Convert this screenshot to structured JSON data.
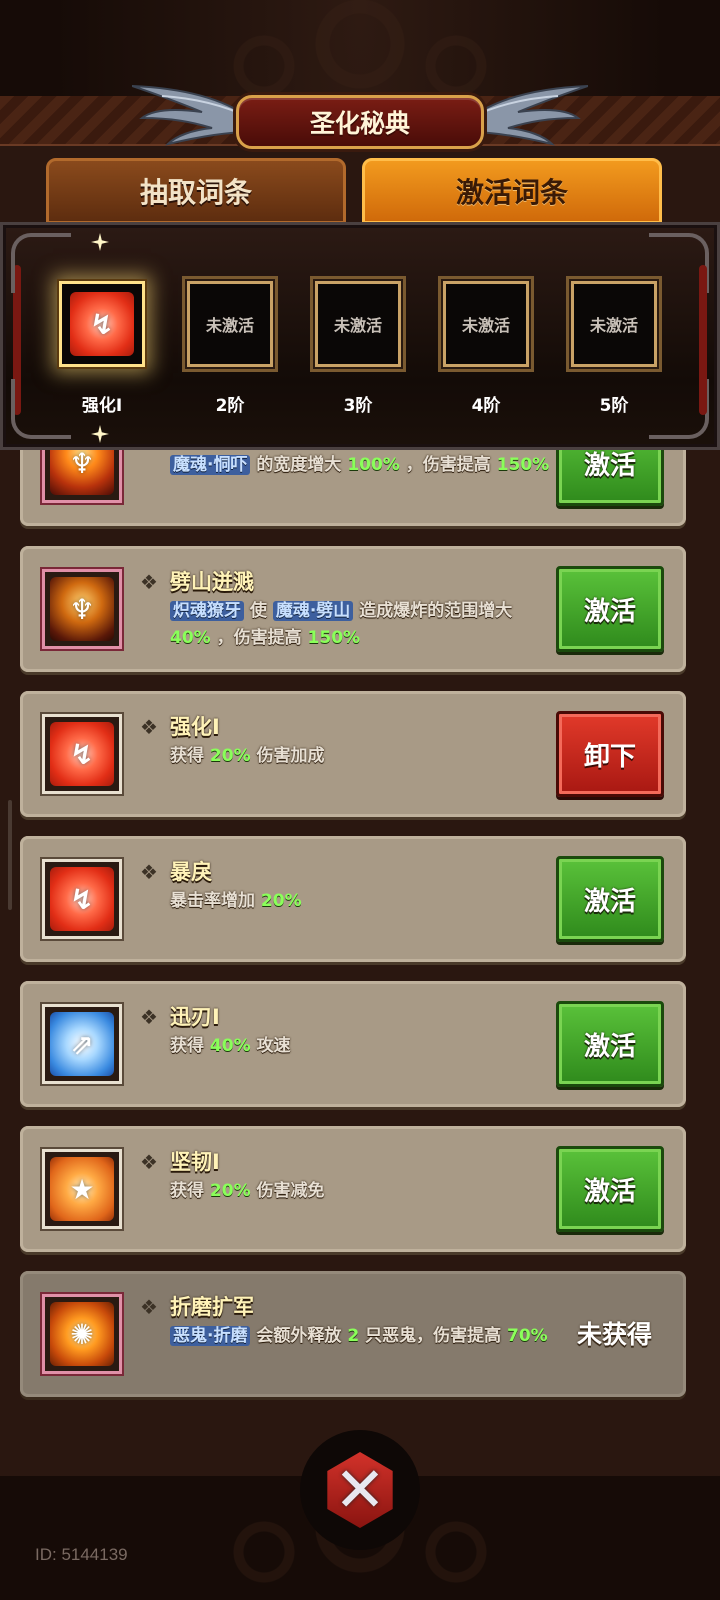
{
  "title": "圣化秘典",
  "tabs": [
    {
      "label": "抽取词条",
      "active": false
    },
    {
      "label": "激活词条",
      "active": true
    }
  ],
  "tiers": [
    {
      "label": "强化I",
      "slot_text": "",
      "icon": "strength-rune-icon",
      "active": true
    },
    {
      "label": "2阶",
      "slot_text": "未激活",
      "active": false
    },
    {
      "label": "3阶",
      "slot_text": "未激活",
      "active": false
    },
    {
      "label": "4阶",
      "slot_text": "未激活",
      "active": false
    },
    {
      "label": "5阶",
      "slot_text": "未激活",
      "active": false
    }
  ],
  "rows": [
    {
      "name": "",
      "icon": "demon-skill-icon",
      "desc_parts": [
        "魔魂·恫吓",
        "的宽度增大",
        "100%",
        "，伤害提高",
        "150%"
      ],
      "button": "激活",
      "button_style": "green"
    },
    {
      "name": "劈山迸溅",
      "icon": "demon-cleave-icon",
      "desc_parts": [
        "炽魂獠牙",
        "使",
        "魔魂·劈山",
        "造成爆炸的范围增大",
        "40%",
        "，伤害提高",
        "150%"
      ],
      "button": "激活",
      "button_style": "green"
    },
    {
      "name": "强化I",
      "icon": "strength-rune-icon",
      "desc_parts": [
        "获得",
        "20%",
        "伤害加成"
      ],
      "button": "卸下",
      "button_style": "red"
    },
    {
      "name": "暴戾",
      "icon": "strength-rune-icon",
      "desc_parts": [
        "暴击率增加",
        "20%"
      ],
      "button": "激活",
      "button_style": "green"
    },
    {
      "name": "迅刃I",
      "icon": "swift-blade-icon",
      "desc_parts": [
        "获得",
        "40%",
        "攻速"
      ],
      "button": "激活",
      "button_style": "green"
    },
    {
      "name": "坚韧I",
      "icon": "shield-star-icon",
      "desc_parts": [
        "获得",
        "20%",
        "伤害减免"
      ],
      "button": "激活",
      "button_style": "green"
    },
    {
      "name": "折磨扩军",
      "icon": "fire-demon-icon",
      "desc_parts": [
        "恶鬼·折磨",
        "会额外释放",
        "2",
        "只恶鬼，伤害提高",
        "70%"
      ],
      "button": "未获得",
      "button_style": "none"
    }
  ],
  "player_id": "ID: 5144139",
  "colors": {
    "accent_green": "#2f8a1c",
    "accent_red": "#a81812",
    "highlight_green": "#8aff5a",
    "highlight_blue": "#3d5f9e",
    "tab_active": "#f29a1e"
  }
}
